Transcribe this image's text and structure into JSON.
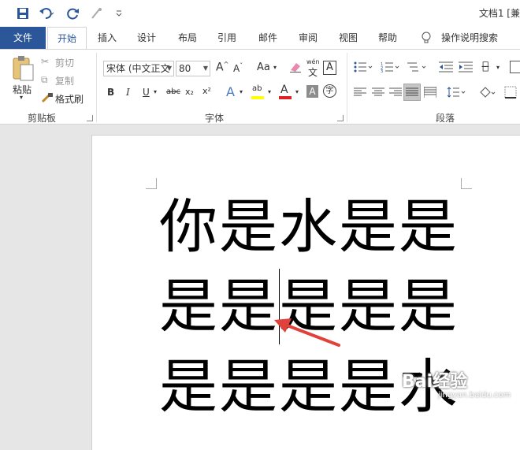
{
  "window": {
    "title": "文档1 [兼"
  },
  "quick_access": {
    "save_icon": "save-icon",
    "undo_icon": "undo-icon",
    "redo_icon": "redo-icon",
    "format_icon": "format-painter-gray-icon",
    "customize_icon": "chevron-down-icon"
  },
  "tabs": [
    {
      "label": "文件"
    },
    {
      "label": "开始"
    },
    {
      "label": "插入"
    },
    {
      "label": "设计"
    },
    {
      "label": "布局"
    },
    {
      "label": "引用"
    },
    {
      "label": "邮件"
    },
    {
      "label": "审阅"
    },
    {
      "label": "视图"
    },
    {
      "label": "帮助"
    },
    {
      "label": "操作说明搜索"
    }
  ],
  "clipboard": {
    "paste": "粘贴",
    "cut": "剪切",
    "copy": "复制",
    "format_painter": "格式刷",
    "group": "剪贴板"
  },
  "font": {
    "name": "宋体 (中文正文",
    "size": "80",
    "group": "字体",
    "bold": "B",
    "italic": "I",
    "underline": "U",
    "strike": "abc",
    "subscript": "x₂",
    "superscript": "x²",
    "aa": "Aa",
    "pinyin_top": "wén",
    "pinyin_char": "文",
    "border_a": "A",
    "clear": "A",
    "highlight": "ab",
    "font_color": "A",
    "shade": "A",
    "circle": "字"
  },
  "paragraph": {
    "group": "段落"
  },
  "document": {
    "lines": [
      "你是水是是",
      "是是是是是",
      "是是是是水"
    ]
  },
  "watermark": {
    "main": "Bai经验",
    "sub": "jingyan.baidu.com"
  },
  "colors": {
    "accent": "#2b579a",
    "arrow": "#e0413a",
    "highlight": "#ffff00",
    "font_red": "#e02020"
  }
}
